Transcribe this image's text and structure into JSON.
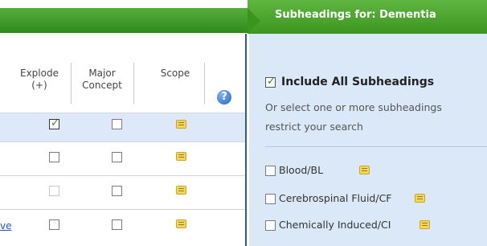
{
  "header": {
    "right_title": "Subheadings for: Dementia"
  },
  "table": {
    "col_explode": "Explode\n(+)",
    "col_major": "Major\nConcept",
    "col_scope": "Scope",
    "help_glyph": "?",
    "rows": [
      {
        "explode": "checked",
        "major": "unchecked"
      },
      {
        "explode": "unchecked",
        "major": "unchecked"
      },
      {
        "explode": "disabled",
        "major": "unchecked"
      },
      {
        "explode": "unchecked",
        "major": "unchecked",
        "link": "ve"
      }
    ]
  },
  "subheadings": {
    "include_all_label": "Include All Subheadings",
    "instruction_line1": "Or select one or more subheadings",
    "instruction_line2": "restrict your search",
    "items": [
      "Blood/BL",
      "Cerebrospinal Fluid/CF",
      "Chemically Induced/CI"
    ]
  }
}
